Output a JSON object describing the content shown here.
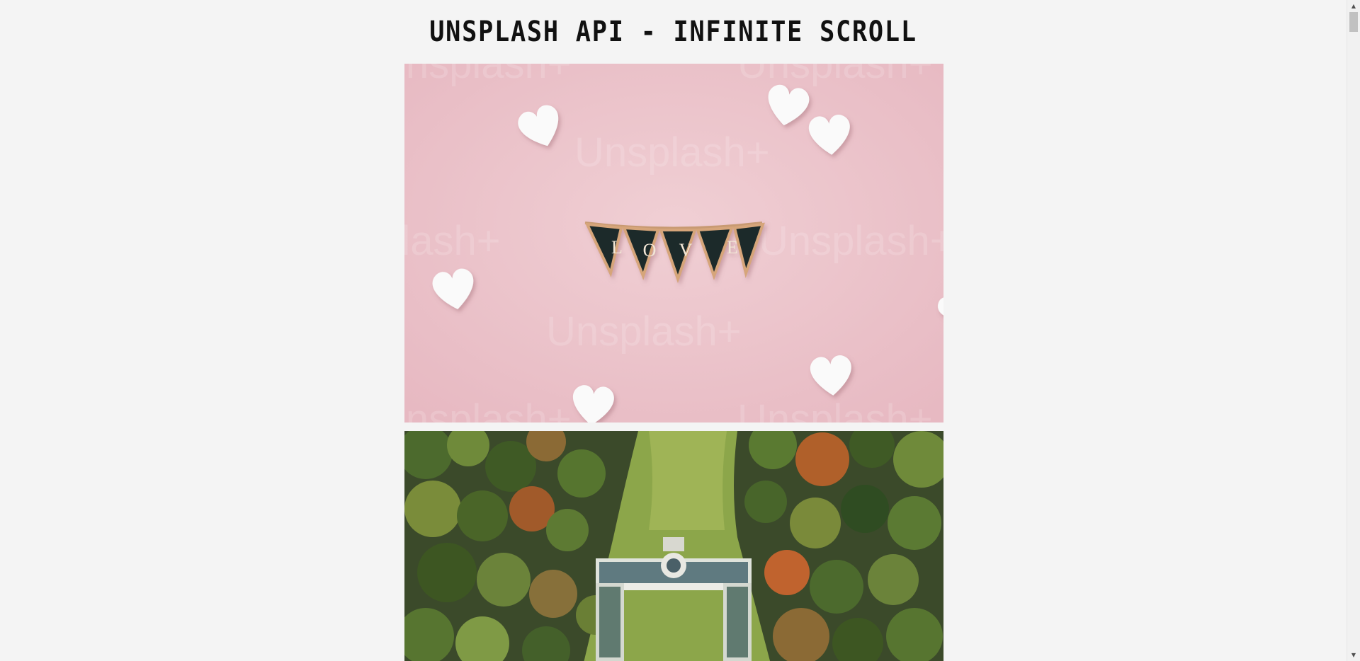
{
  "page": {
    "title": "UNSPLASH API - INFINITE SCROLL"
  },
  "photos": [
    {
      "subject": "pink-background-love-banner-with-hearts",
      "banner_letters": [
        "L",
        "O",
        "V",
        "E"
      ],
      "watermark": "Unsplash+"
    },
    {
      "subject": "aerial-view-mansion-in-autumn-forest"
    }
  ],
  "scrollbar": {
    "up_icon": "triangle-up",
    "down_icon": "triangle-down"
  },
  "colors": {
    "background": "#f4f4f4",
    "title": "#111111",
    "photo_pink": "#ecc4cb"
  }
}
